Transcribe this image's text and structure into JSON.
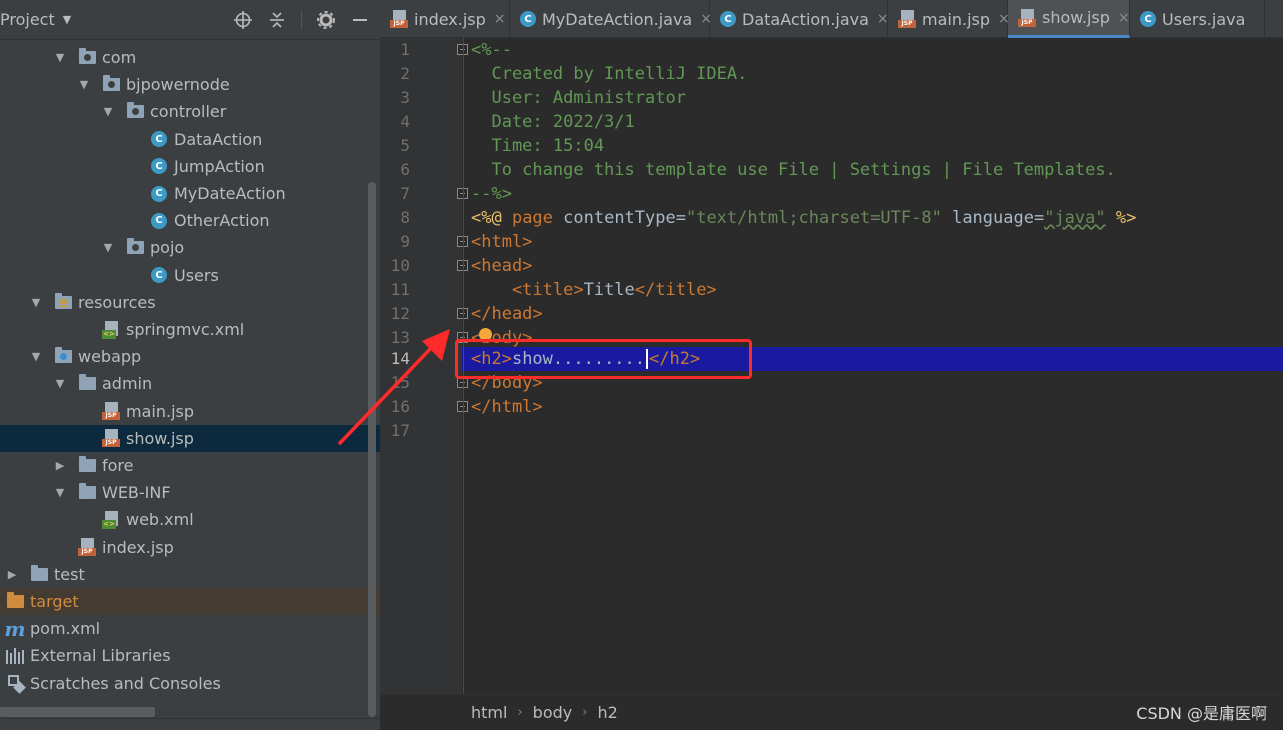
{
  "project_panel": {
    "title": "Project",
    "tools": [
      "locate-icon",
      "collapse-icon",
      "gear-icon",
      "minimize-icon"
    ],
    "tree": [
      {
        "label": "com",
        "type": "package",
        "expanded": true
      },
      {
        "label": "bjpowernode",
        "type": "package",
        "expanded": true
      },
      {
        "label": "controller",
        "type": "package",
        "expanded": true
      },
      {
        "label": "DataAction",
        "type": "class"
      },
      {
        "label": "JumpAction",
        "type": "class"
      },
      {
        "label": "MyDateAction",
        "type": "class"
      },
      {
        "label": "OtherAction",
        "type": "class"
      },
      {
        "label": "pojo",
        "type": "package",
        "expanded": true
      },
      {
        "label": "Users",
        "type": "class"
      },
      {
        "label": "resources",
        "type": "resources-folder",
        "expanded": true
      },
      {
        "label": "springmvc.xml",
        "type": "xml"
      },
      {
        "label": "webapp",
        "type": "web-folder",
        "expanded": true
      },
      {
        "label": "admin",
        "type": "folder",
        "expanded": true
      },
      {
        "label": "main.jsp",
        "type": "jsp"
      },
      {
        "label": "show.jsp",
        "type": "jsp",
        "selected": true
      },
      {
        "label": "fore",
        "type": "folder",
        "expanded": false
      },
      {
        "label": "WEB-INF",
        "type": "folder",
        "expanded": true
      },
      {
        "label": "web.xml",
        "type": "xml"
      },
      {
        "label": "index.jsp",
        "type": "jsp"
      },
      {
        "label": "test",
        "type": "folder",
        "expanded": false
      },
      {
        "label": "target",
        "type": "excluded-folder",
        "expanded": false
      },
      {
        "label": "pom.xml",
        "type": "maven"
      },
      {
        "label": "External Libraries",
        "type": "libraries"
      },
      {
        "label": "Scratches and Consoles",
        "type": "scratches"
      }
    ]
  },
  "tabs": [
    {
      "label": "index.jsp",
      "type": "jsp"
    },
    {
      "label": "MyDateAction.java",
      "type": "class"
    },
    {
      "label": "DataAction.java",
      "type": "class"
    },
    {
      "label": "main.jsp",
      "type": "jsp"
    },
    {
      "label": "show.jsp",
      "type": "jsp",
      "active": true
    },
    {
      "label": "Users.java",
      "type": "class"
    }
  ],
  "editor": {
    "current_line": 14,
    "line_numbers": [
      "1",
      "2",
      "3",
      "4",
      "5",
      "6",
      "7",
      "8",
      "9",
      "10",
      "11",
      "12",
      "13",
      "14",
      "15",
      "16",
      "17"
    ],
    "code": {
      "l1": "<%--",
      "l2": "  Created by IntelliJ IDEA.",
      "l3": "  User: Administrator",
      "l4": "  Date: 2022/3/1",
      "l5": "  Time: 15:04",
      "l6": "  To change this template use File | Settings | File Templates.",
      "l7": "--%>",
      "l8_open": "<%@ ",
      "l8_page": "page",
      "l8_attr1": " contentType=",
      "l8_val1": "\"text/html;charset=UTF-8\"",
      "l8_attr2": " language=",
      "l8_val2": "\"java\"",
      "l8_close": " %>",
      "l9": "<html>",
      "l10": "<head>",
      "l11_open": "    <title>",
      "l11_text": "Title",
      "l11_close": "</title>",
      "l12": "</head>",
      "l13": "<body>",
      "l14_open": "<h2>",
      "l14_text": "show.........",
      "l14_close": "</h2>",
      "l15": "</body>",
      "l16": "</html>"
    }
  },
  "breadcrumb": [
    "html",
    "body",
    "h2"
  ],
  "watermark": "CSDN @是庸医啊",
  "colors": {
    "highlight_box": "#ff2a2a",
    "current_line": "#1a1aa0",
    "accent": "#4a88c7"
  }
}
